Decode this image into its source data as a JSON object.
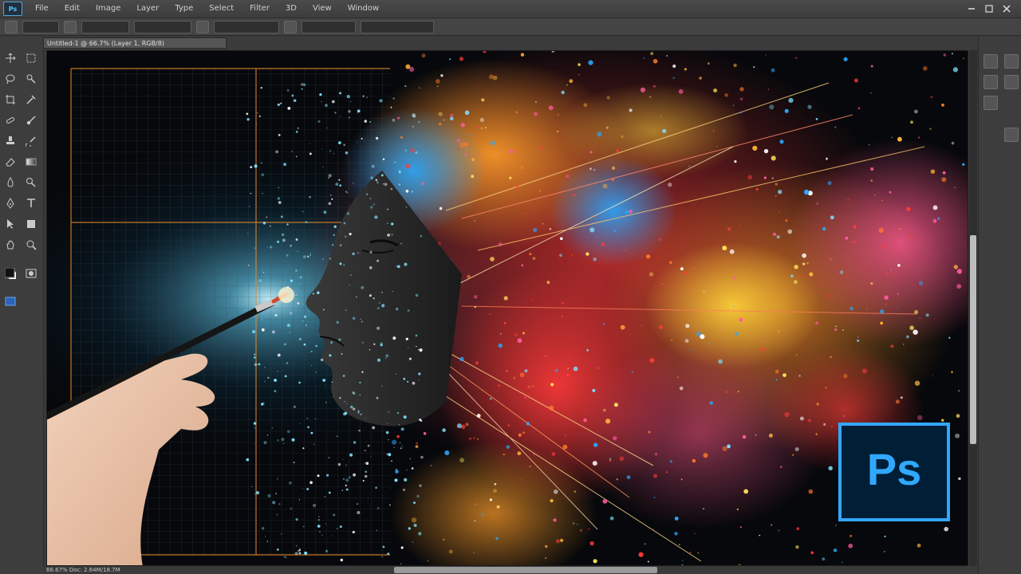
{
  "app": {
    "badge": "Ps",
    "menu": [
      "File",
      "Edit",
      "Image",
      "Layer",
      "Type",
      "Select",
      "Filter",
      "3D",
      "View",
      "Window"
    ]
  },
  "document": {
    "tab_label": "Untitled-1 @ 66.7% (Layer 1, RGB/8)",
    "status_text": "66.67%    Doc: 2.64M/18.7M"
  },
  "artwork": {
    "logo_text": "Ps"
  },
  "colors": {
    "accent": "#31a8ff",
    "guide": "#e38a2e",
    "logo_bg": "#001e36",
    "ui_bg": "#3b3b3b"
  },
  "icons": {
    "left_toolbar": [
      "move-icon",
      "marquee-icon",
      "lasso-icon",
      "quick-select-icon",
      "crop-icon",
      "eyedropper-icon",
      "healing-brush-icon",
      "brush-icon",
      "clone-stamp-icon",
      "history-brush-icon",
      "eraser-icon",
      "gradient-icon",
      "blur-icon",
      "dodge-icon",
      "pen-icon",
      "type-icon",
      "path-select-icon",
      "shape-icon",
      "hand-icon",
      "zoom-icon",
      "foreground-color-icon",
      "quick-mask-icon",
      "screen-mode-icon"
    ],
    "right_panel": [
      "history-panel-icon",
      "properties-panel-icon",
      "layers-panel-icon",
      "channels-panel-icon",
      "paths-panel-icon",
      "color-panel-icon"
    ]
  }
}
